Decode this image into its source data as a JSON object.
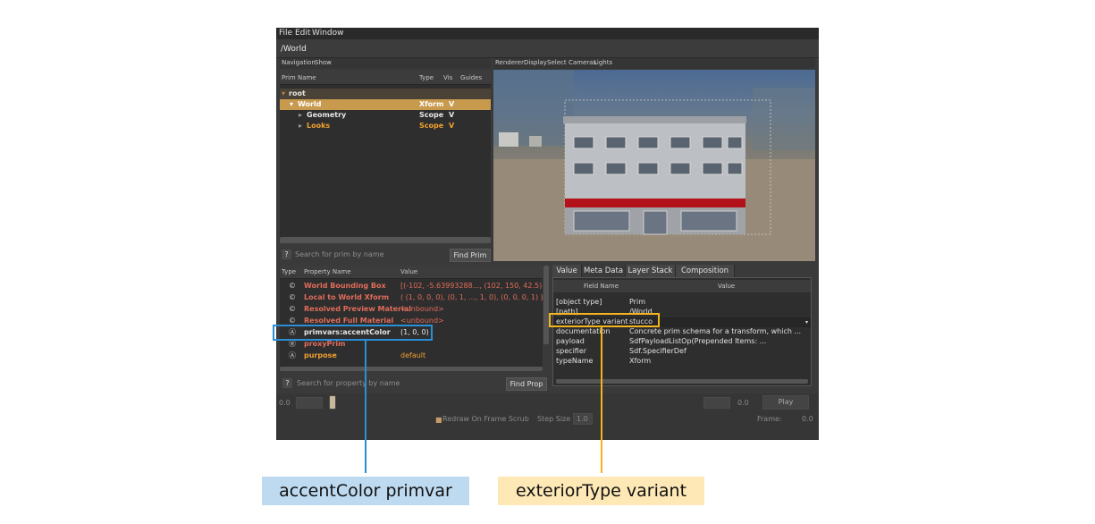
{
  "menu": [
    "File",
    "Edit",
    "Window"
  ],
  "path": "/World",
  "nav_menu": [
    "Navigation",
    "Show"
  ],
  "view_menu": [
    "Renderer",
    "Display",
    "Select",
    "Cameras",
    "Lights"
  ],
  "prim_tree": {
    "headers": [
      "Prim Name",
      "Type",
      "Vis",
      "Guides"
    ],
    "rows": [
      {
        "arrow": "▾",
        "name": "root",
        "type": "",
        "vis": ""
      },
      {
        "arrow": "▾",
        "name": "World",
        "type": "Xform",
        "vis": "V"
      },
      {
        "arrow": "▸",
        "name": "Geometry",
        "type": "Scope",
        "vis": "V"
      },
      {
        "arrow": "▸",
        "name": "Looks",
        "type": "Scope",
        "vis": "V"
      }
    ],
    "search_placeholder": "Search for prim by name",
    "find_label": "Find Prim"
  },
  "properties": {
    "headers": [
      "Type",
      "Property Name",
      "Value"
    ],
    "rows": [
      {
        "icon": "©",
        "name": "World Bounding Box",
        "value": "[(-102, -5.63993288..., (102, 150, 42.5)]"
      },
      {
        "icon": "©",
        "name": "Local to World Xform",
        "value": "( (1, 0, 0, 0), (0, 1, ..., 1, 0), (0, 0, 0, 1) )"
      },
      {
        "icon": "©",
        "name": "Resolved Preview Material",
        "value": "<unbound>"
      },
      {
        "icon": "©",
        "name": "Resolved Full Material",
        "value": "<unbound>"
      },
      {
        "icon": "Ⓐ",
        "name": "primvars:accentColor",
        "value": "(1, 0, 0)"
      },
      {
        "icon": "Ⓡ",
        "name": "proxyPrim",
        "value": ""
      },
      {
        "icon": "Ⓐ",
        "name": "purpose",
        "value": "default"
      }
    ],
    "search_placeholder": "Search for property by name",
    "find_label": "Find Prop"
  },
  "tabs": [
    "Value",
    "Meta Data",
    "Layer Stack",
    "Composition"
  ],
  "metadata": {
    "headers": [
      "Field Name",
      "Value"
    ],
    "rows": [
      {
        "field": "[object type]",
        "value": "Prim"
      },
      {
        "field": "[path]",
        "value": "/World"
      },
      {
        "field": "exteriorType variant",
        "value": "stucco"
      },
      {
        "field": "documentation",
        "value": "Concrete prim schema for a transform, which ..."
      },
      {
        "field": "payload",
        "value": "SdfPayloadListOp(Prepended Items: ..."
      },
      {
        "field": "specifier",
        "value": "Sdf.SpecifierDef"
      },
      {
        "field": "typeName",
        "value": "Xform"
      }
    ]
  },
  "timeline": {
    "start": "0.0",
    "end": "0.0",
    "play_label": "Play",
    "redraw_label": "Redraw On Frame Scrub",
    "step_label": "Step Size",
    "step_value": "1.0",
    "frame_label": "Frame:",
    "frame_value": "0.0"
  },
  "callouts": {
    "blue": "accentColor primvar",
    "yellow": "exteriorType variant"
  },
  "colors": {
    "accent_orange": "#f0a030",
    "prop_red": "#e06c5a",
    "highlight_blue": "#2a8fd6",
    "highlight_yellow": "#f2b51e"
  }
}
